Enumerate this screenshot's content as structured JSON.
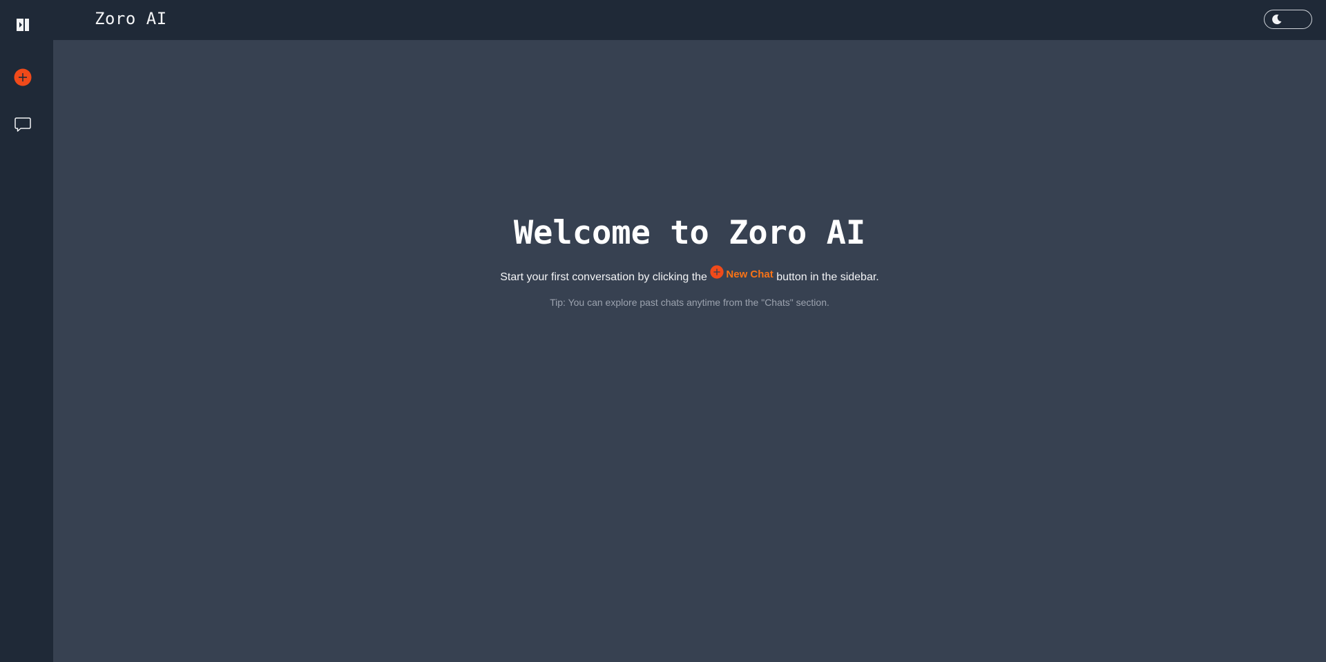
{
  "app": {
    "title": "Zoro AI"
  },
  "sidebar": {
    "items": [
      {
        "name": "toggle-sidebar",
        "icon": "sidebar-toggle-icon"
      },
      {
        "name": "new-chat",
        "icon": "plus-circle-icon"
      },
      {
        "name": "chats",
        "icon": "chat-bubble-icon"
      }
    ]
  },
  "header": {
    "theme_toggle_icon": "moon-icon"
  },
  "welcome": {
    "title": "Welcome to Zoro AI",
    "subtitle_before": "Start your first conversation by clicking the",
    "new_chat_label": "New Chat",
    "subtitle_after": "button in the sidebar.",
    "tip": "Tip: You can explore past chats anytime from the \"Chats\" section."
  },
  "colors": {
    "accent": "#f97316",
    "sidebar_bg": "#1f2937",
    "main_bg": "#374151"
  }
}
